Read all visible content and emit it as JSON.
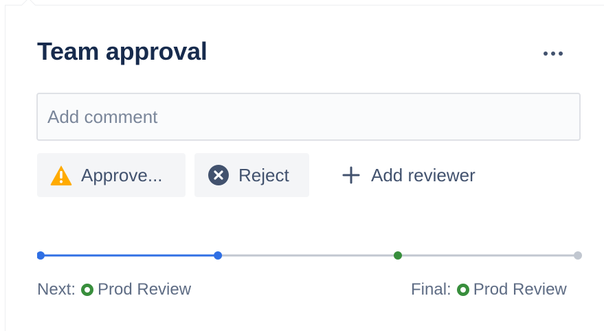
{
  "header": {
    "title": "Team approval"
  },
  "icons": {
    "more": "more-horizontal-icon",
    "approve": "warning-icon",
    "reject": "cross-circle-icon",
    "add": "plus-icon",
    "stage": "status-dot-icon"
  },
  "comment": {
    "placeholder": "Add comment",
    "value": ""
  },
  "actions": {
    "approve_label": "Approve...",
    "reject_label": "Reject",
    "add_reviewer_label": "Add reviewer"
  },
  "progress": {
    "completed_fraction": 0.33,
    "stages": 4
  },
  "stages": {
    "next_prefix": "Next:",
    "next_name": "Prod Review",
    "final_prefix": "Final:",
    "final_name": "Prod Review"
  },
  "colors": {
    "title": "#172b4d",
    "progress_complete": "#2f6fe4",
    "progress_pending": "#c1c7d0",
    "stage_current": "#388e3c",
    "warning": "#ffab00",
    "reject_icon": "#42526e"
  }
}
